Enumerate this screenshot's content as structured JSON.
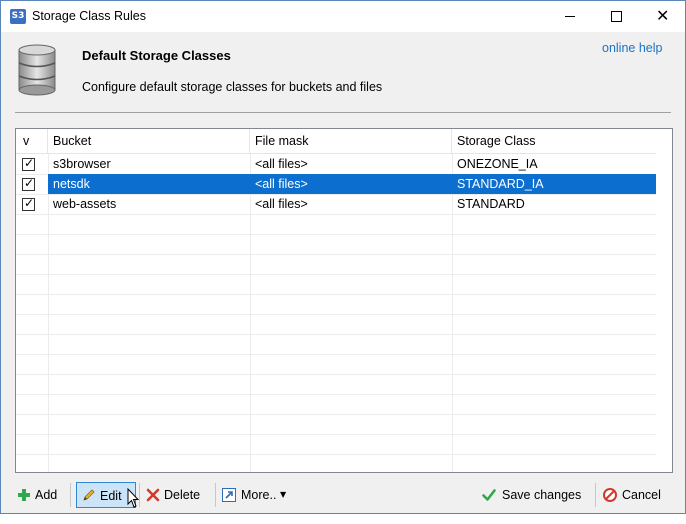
{
  "window": {
    "title": "Storage Class Rules",
    "app_icon_text": "S3"
  },
  "header": {
    "title": "Default Storage Classes",
    "description": "Configure default storage classes for buckets and files",
    "help_link": "online help"
  },
  "grid": {
    "columns": [
      "v",
      "Bucket",
      "File mask",
      "Storage Class"
    ],
    "rows": [
      {
        "checked": true,
        "bucket": "s3browser",
        "mask": "<all files>",
        "storage_class": "ONEZONE_IA",
        "selected": false
      },
      {
        "checked": true,
        "bucket": "netsdk",
        "mask": "<all files>",
        "storage_class": "STANDARD_IA",
        "selected": true
      },
      {
        "checked": true,
        "bucket": "web-assets",
        "mask": "<all files>",
        "storage_class": "STANDARD",
        "selected": false
      }
    ],
    "selection_color": "#0c6fcf"
  },
  "toolbar": {
    "add_label": "Add",
    "edit_label": "Edit",
    "delete_label": "Delete",
    "more_label": "More..",
    "save_label": "Save changes",
    "cancel_label": "Cancel"
  },
  "icons": {
    "add": "plus-icon",
    "edit": "pencil-icon",
    "delete": "x-icon",
    "more": "arrow-icon",
    "save": "checkmark-icon",
    "cancel": "no-entry-icon",
    "header": "database-icon"
  }
}
